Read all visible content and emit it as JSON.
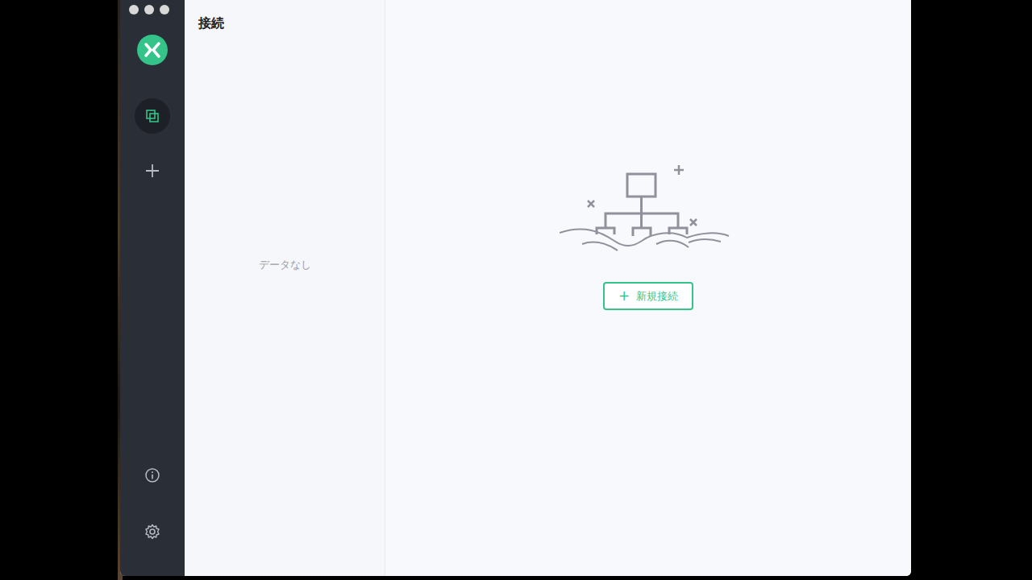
{
  "sidebar": {
    "items": [
      {
        "kind": "connections",
        "selected": true
      },
      {
        "kind": "add",
        "selected": false
      }
    ],
    "bottom": [
      {
        "kind": "about"
      },
      {
        "kind": "settings"
      }
    ]
  },
  "connections_panel": {
    "title": "接続",
    "empty_text": "データなし"
  },
  "main": {
    "new_button": {
      "icon": "+",
      "label": "新規接続"
    }
  }
}
